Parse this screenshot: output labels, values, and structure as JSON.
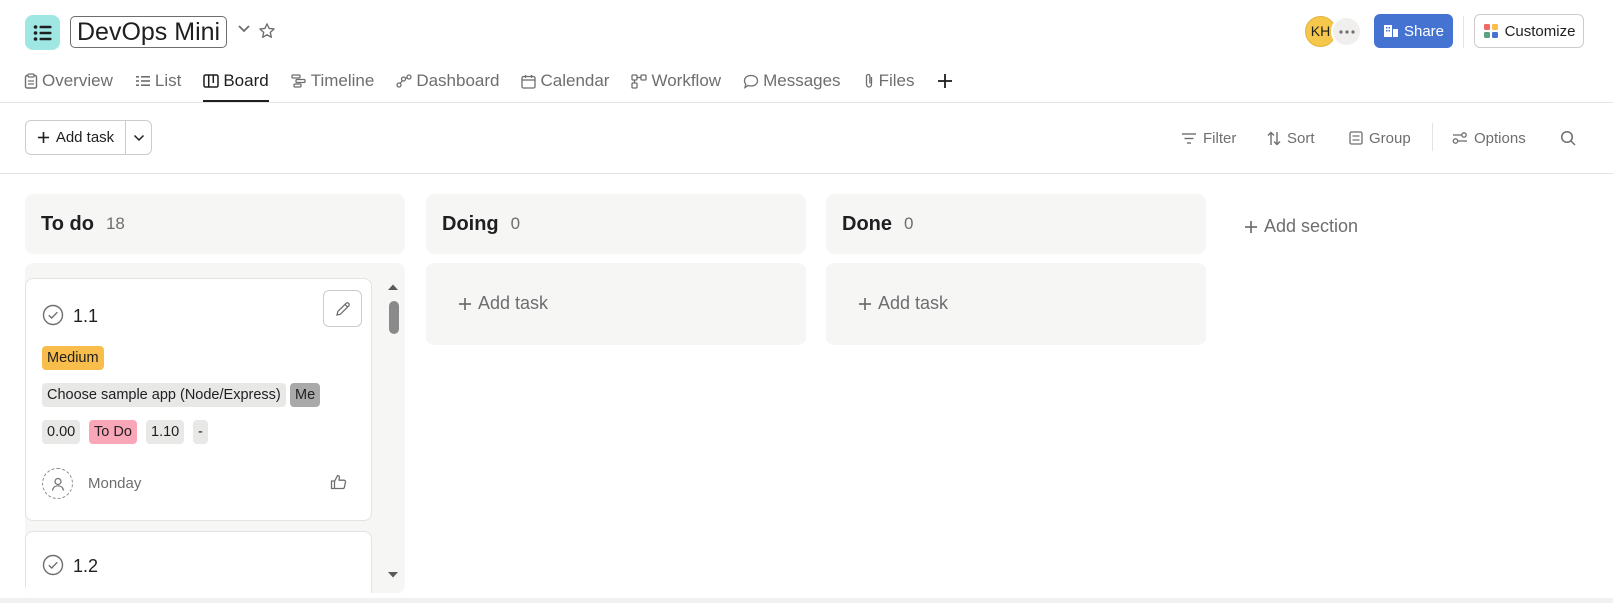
{
  "header": {
    "project_title": "DevOps Mini",
    "avatar_initials": "KH",
    "share_label": "Share",
    "customize_label": "Customize"
  },
  "tabs": [
    {
      "label": "Overview",
      "icon": "clipboard-icon"
    },
    {
      "label": "List",
      "icon": "list-icon"
    },
    {
      "label": "Board",
      "icon": "board-icon",
      "active": true
    },
    {
      "label": "Timeline",
      "icon": "timeline-icon"
    },
    {
      "label": "Dashboard",
      "icon": "dashboard-icon"
    },
    {
      "label": "Calendar",
      "icon": "calendar-icon"
    },
    {
      "label": "Workflow",
      "icon": "workflow-icon"
    },
    {
      "label": "Messages",
      "icon": "message-icon"
    },
    {
      "label": "Files",
      "icon": "paperclip-icon"
    }
  ],
  "toolbar": {
    "add_task_label": "Add task",
    "filter_label": "Filter",
    "sort_label": "Sort",
    "group_label": "Group",
    "options_label": "Options"
  },
  "board": {
    "columns": [
      {
        "name": "To do",
        "count": "18"
      },
      {
        "name": "Doing",
        "count": "0",
        "add_label": "Add task"
      },
      {
        "name": "Done",
        "count": "0",
        "add_label": "Add task"
      }
    ],
    "add_section_label": "Add section",
    "cards": [
      {
        "name": "1.1",
        "priority": "Medium",
        "description": "Choose sample app (Node/Express)",
        "owner_tag": "Me",
        "estimate": "0.00",
        "status": "To Do",
        "version": "1.10",
        "extra": "-",
        "due": "Monday"
      },
      {
        "name": "1.2"
      }
    ]
  },
  "colors": {
    "accent": "#4573d2",
    "project_icon_bg": "#9ee7e3",
    "priority_medium": "#f8bd4a",
    "status_todo": "#f9a6b8",
    "avatar": "#f5c84c"
  }
}
